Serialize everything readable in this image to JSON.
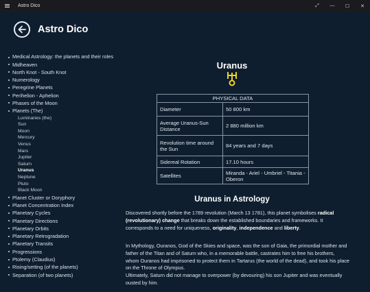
{
  "window": {
    "title": "Astro Dico",
    "controls": {
      "maximize_icon": "⤢",
      "minimize": "—",
      "restore": "☐",
      "close": "✕"
    }
  },
  "header": {
    "title": "Astro Dico",
    "back_icon": "back-arrow-icon"
  },
  "sidebar": {
    "items": [
      {
        "label": "Medical Astrology: the planets and their roles",
        "wrap": true
      },
      {
        "label": "Midheaven"
      },
      {
        "label": "North Knot - South Knot"
      },
      {
        "label": "Numerology"
      },
      {
        "label": "Peregrine Planets"
      },
      {
        "label": "Perihelion - Aphelion"
      },
      {
        "label": "Phases of the Moon"
      },
      {
        "label": "Planets (The)"
      }
    ],
    "sub_items": [
      "Luminaries (the)",
      "Sun",
      "Moon",
      "Mercury",
      "Venus",
      "Mars",
      "Jupiter",
      "Saturn",
      "Uranus",
      "Neptune",
      "Pluto",
      "Black Moon"
    ],
    "active_sub": "Uranus",
    "items_after": [
      {
        "label": "Planet Cluster or Doryphory"
      },
      {
        "label": "Planet Concentration Index"
      },
      {
        "label": "Planetary Cycles"
      },
      {
        "label": "Planetary Directions"
      },
      {
        "label": "Planetary Orbits"
      },
      {
        "label": "Planetary Retrogradation"
      },
      {
        "label": "Planetary Transits"
      },
      {
        "label": "Progressions"
      },
      {
        "label": "Ptolemy (Claudius)"
      },
      {
        "label": "Rising/setting (of the planets)"
      },
      {
        "label": "Separation (of two planets)"
      }
    ]
  },
  "main": {
    "planet_name": "Uranus",
    "symbol_icon": "uranus-symbol-icon",
    "symbol_color": "#f2d22b",
    "table": {
      "header": "PHYSICAL DATA",
      "rows": [
        {
          "label": "Diameter",
          "value": "50 800 km"
        },
        {
          "label": "Average Uranus-Sun Distance",
          "value": "2 880 million km"
        },
        {
          "label": "Revolution time around the Sun",
          "value": "84 years and 7 days"
        },
        {
          "label": "Sidereal Rotation",
          "value": "17.10 hours"
        },
        {
          "label": "Satellites",
          "value": "Miranda - Ariel - Umbriel - Titania - Oberon"
        }
      ]
    },
    "section_title": "Uranus in Astrology",
    "p1": {
      "t1": "Discovered shortly before the 1789 revolution (March 13 1781), this planet symbolises ",
      "b1": "radical (revolutionary) change",
      "t2": " that breaks down the established boundaries and frameworks. It corresponds to a need for uniqueness, ",
      "b2": "originality",
      "t3": ", ",
      "b3": "independence",
      "t4": " and ",
      "b4": "liberty",
      "t5": "."
    },
    "p2": "In Mythology, Ouranos, God of the Skies and space, was the son of Gaia, the primordial mother and father of the Titan and of Saturn who, in a memorable battle, castrates him to free his brothers, whom Ouranos had imprisoned to protect them in Tartarus (the world of the dead), and took his place on the Throne of Olympus.",
    "p3": "Ultimately, Saturn did not manage to overpower (by devouring) his son Jupiter and was eventually ousted by him."
  },
  "colors": {
    "background": "#0f1e2e",
    "titlebar": "#1b1b1f",
    "accent": "#f2d22b"
  }
}
